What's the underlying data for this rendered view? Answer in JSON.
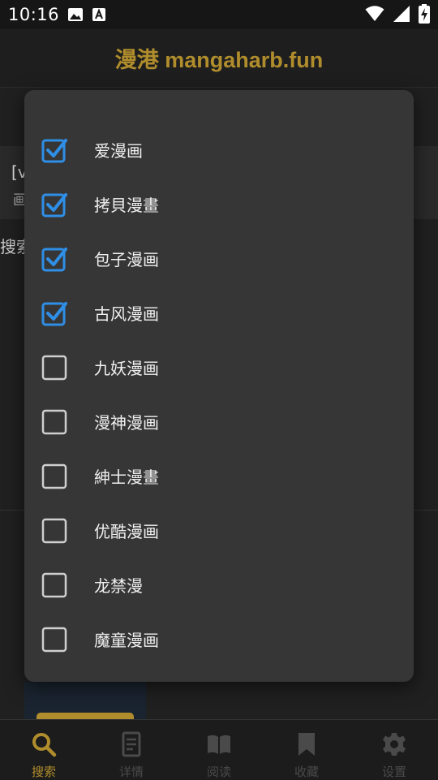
{
  "status_bar": {
    "time": "10:16"
  },
  "header": {
    "title": "漫港 mangaharb.fun"
  },
  "background": {
    "card_line1": "[v",
    "card_line2": "画",
    "search_fragment": "搜索"
  },
  "dialog": {
    "options": [
      {
        "label": "爱漫画",
        "checked": true
      },
      {
        "label": "拷貝漫畫",
        "checked": true
      },
      {
        "label": "包子漫画",
        "checked": true
      },
      {
        "label": "古风漫画",
        "checked": true
      },
      {
        "label": "九妖漫画",
        "checked": false
      },
      {
        "label": "漫神漫画",
        "checked": false
      },
      {
        "label": "紳士漫畫",
        "checked": false
      },
      {
        "label": "优酷漫画",
        "checked": false
      },
      {
        "label": "龙禁漫",
        "checked": false
      },
      {
        "label": "魔童漫画",
        "checked": false
      }
    ]
  },
  "bottom_nav": [
    {
      "label": "搜索",
      "icon": "search-icon",
      "active": true
    },
    {
      "label": "详情",
      "icon": "document-icon",
      "active": false
    },
    {
      "label": "阅读",
      "icon": "book-icon",
      "active": false
    },
    {
      "label": "收藏",
      "icon": "bookmark-icon",
      "active": false
    },
    {
      "label": "设置",
      "icon": "gear-icon",
      "active": false
    }
  ],
  "colors": {
    "accent": "#b08d2c",
    "checkbox_checked": "#2f8fe6",
    "checkbox_unchecked": "#cfcfcf",
    "dialog_bg": "#363636"
  }
}
